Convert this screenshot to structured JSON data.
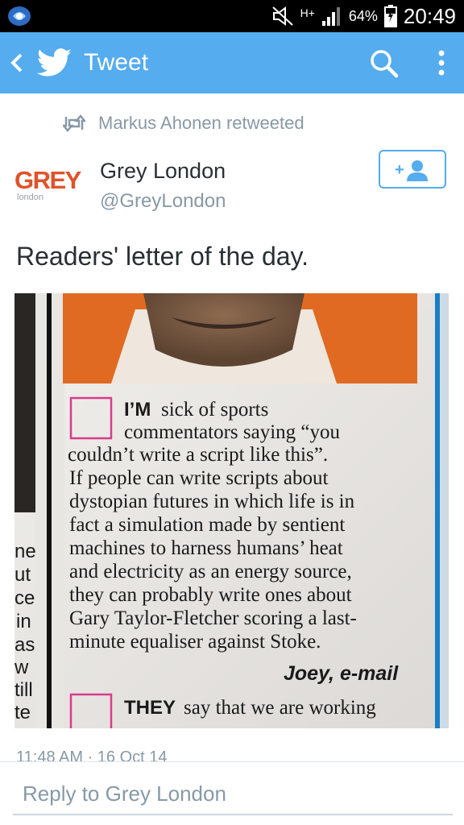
{
  "status_bar": {
    "network": "H+",
    "battery": "64%",
    "time": "20:49"
  },
  "action_bar": {
    "title": "Tweet",
    "icons": [
      "back-icon",
      "twitter-bird-icon",
      "search-icon",
      "overflow-menu-icon"
    ]
  },
  "retweet": {
    "label": "Markus Ahonen retweeted"
  },
  "author": {
    "logo_text": "GREY",
    "logo_subtext": "london",
    "name": "Grey London",
    "handle": "@GreyLondon"
  },
  "follow_button": {
    "label": "+👤",
    "icon": "follow-user-icon"
  },
  "tweet": {
    "text": "Readers' letter of the day.",
    "timestamp": "11:48 AM · 16 Oct 14"
  },
  "photo": {
    "letter_lead": "I’M",
    "letter_lines": [
      "sick of sports",
      "commentators saying “you",
      "couldn’t write a script like this”.",
      "If people can write scripts about",
      "dystopian futures in which life is in",
      "fact a simulation made by sentient",
      "machines to harness humans’ heat",
      "and electricity as an energy source,",
      "they can probably write ones about",
      "Gary Taylor-Fletcher scoring a last-",
      "minute equaliser against Stoke."
    ],
    "signature": "Joey, e-mail",
    "next_lead": "THEY",
    "next_text": "say that we are working",
    "left_fragments": [
      "ne",
      "ut",
      "ce",
      "in",
      "as",
      "w",
      "till",
      "te"
    ]
  },
  "reply": {
    "placeholder": "Reply to Grey London"
  },
  "colors": {
    "twitter_blue": "#55acee",
    "status_black": "#000000",
    "grey_logo": "#e0532a"
  }
}
